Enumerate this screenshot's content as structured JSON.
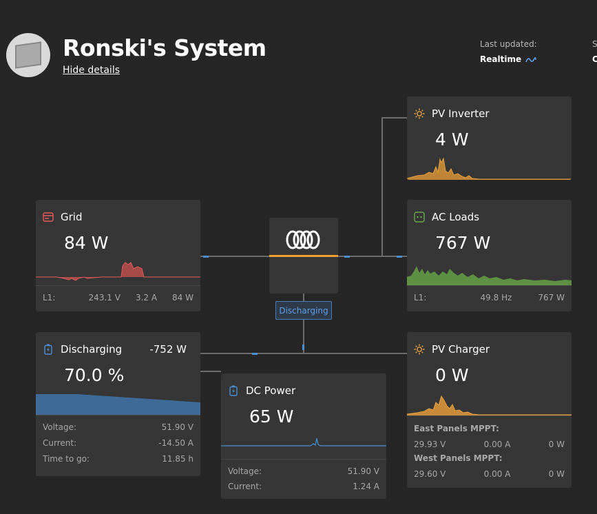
{
  "header": {
    "title": "Ronski's System",
    "hide_details": "Hide details",
    "last_updated_label": "Last updated:",
    "last_updated_value": "Realtime",
    "cut_label": "S",
    "cut_value": "C"
  },
  "inverter": {
    "badge": "Discharging"
  },
  "cards": {
    "pv_inverter": {
      "title": "PV Inverter",
      "value": "4 W"
    },
    "grid": {
      "title": "Grid",
      "value": "84 W",
      "footer": {
        "phase": "L1:",
        "voltage": "243.1 V",
        "current": "3.2 A",
        "power": "84 W"
      }
    },
    "ac_loads": {
      "title": "AC Loads",
      "value": "767 W",
      "footer": {
        "phase": "L1:",
        "frequency": "49.8 Hz",
        "power": "767 W"
      }
    },
    "battery": {
      "title": "Discharging",
      "power": "-752 W",
      "value": "70.0 %",
      "soc_fraction": 0.7,
      "rows": [
        {
          "label": "Voltage:",
          "value": "51.90 V"
        },
        {
          "label": "Current:",
          "value": "-14.50 A"
        },
        {
          "label": "Time to go:",
          "value": "11.85 h"
        }
      ]
    },
    "dc_power": {
      "title": "DC Power",
      "value": "65 W",
      "rows": [
        {
          "label": "Voltage:",
          "value": "51.90 V"
        },
        {
          "label": "Current:",
          "value": "1.24 A"
        }
      ]
    },
    "pv_charger": {
      "title": "PV Charger",
      "value": "0 W",
      "mppts": [
        {
          "name": "East Panels MPPT:",
          "voltage": "29.93 V",
          "current": "0.00 A",
          "power": "0 W"
        },
        {
          "name": "West Panels MPPT:",
          "voltage": "29.60 V",
          "current": "0.00 A",
          "power": "0 W"
        }
      ]
    }
  },
  "colors": {
    "solar": "#e6a040",
    "grid": "#e25b5b",
    "loads": "#6aa84f",
    "battery": "#4a8fd1",
    "inverter_bar": "#f0a030"
  },
  "icons": {
    "pv": "sun-icon",
    "grid": "grid-icon",
    "loads": "outlet-icon",
    "battery": "battery-icon",
    "logo": "victron-logo"
  }
}
